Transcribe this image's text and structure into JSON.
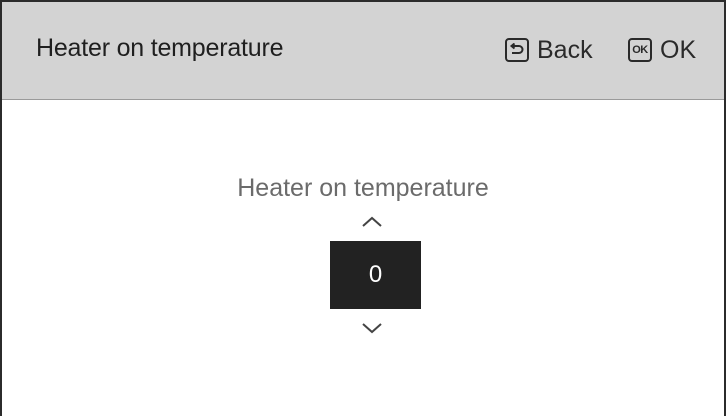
{
  "header": {
    "title": "Heater on temperature",
    "back_label": "Back",
    "ok_label": "OK",
    "ok_icon_text": "OK",
    "background_color": "#d3d3d3"
  },
  "content": {
    "label": "Heater on temperature",
    "value": "0",
    "value_box_color": "#222222"
  },
  "icons": {
    "back": "back-return-icon",
    "ok": "ok-key-icon",
    "increase": "chevron-up-icon",
    "decrease": "chevron-down-icon"
  }
}
